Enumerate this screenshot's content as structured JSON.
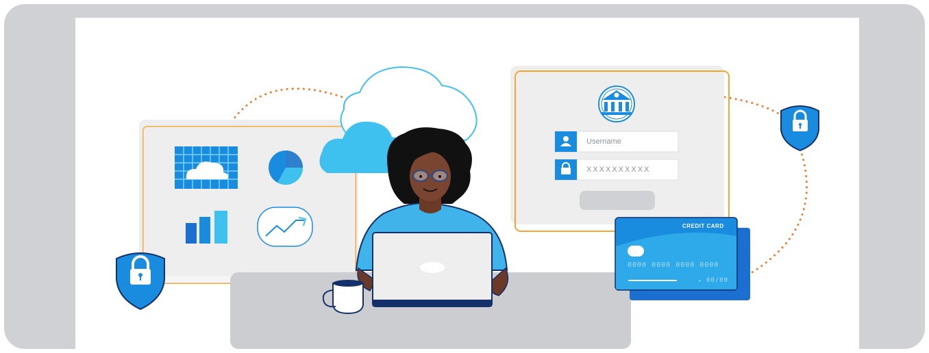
{
  "login": {
    "username_placeholder": "Username",
    "password_placeholder": "XXXXXXXXXX"
  },
  "credit_card": {
    "label": "CREDIT CARD",
    "number": "0000 0000 0000 0000",
    "expiry": "00/00"
  },
  "colors": {
    "accent_blue": "#1a8ce0",
    "light_blue": "#3fc1f0",
    "orange": "#f5a531",
    "dot_orange": "#ee7a2a",
    "navy": "#14306b",
    "panel_gray": "#efeeef",
    "frame_gray": "#d0d1d5"
  },
  "icons": [
    "shield-lock-icon",
    "bank-icon",
    "user-icon",
    "lock-icon",
    "cloud-icon",
    "pie-chart-icon",
    "bar-chart-icon",
    "trend-line-icon",
    "coffee-mug-icon",
    "laptop-icon"
  ]
}
